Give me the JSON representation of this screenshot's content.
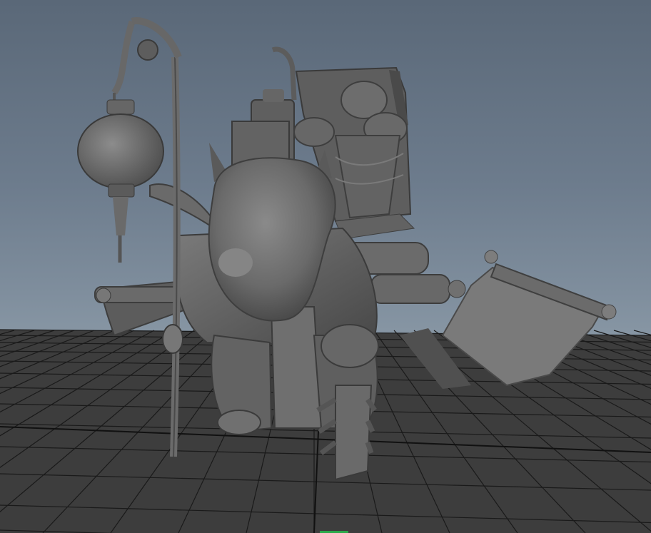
{
  "viewport": {
    "background_top": "#5a6878",
    "background_bottom": "#8695a3",
    "grid_color": "#1c1c1c",
    "grid_fill": "#3f3f3f",
    "model_fill": "#6e6e6e",
    "model_shade": "#505050",
    "model_light": "#8a8a8a",
    "highlight_color": "#2aa84a"
  }
}
